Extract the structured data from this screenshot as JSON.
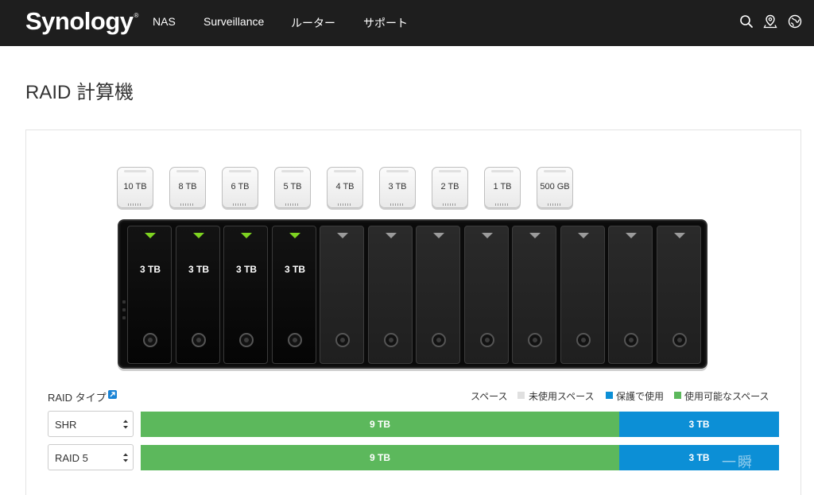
{
  "nav": {
    "logo": "Synology",
    "logo_mark": "®",
    "links": [
      "NAS",
      "Surveillance",
      "ルーター",
      "サポート"
    ],
    "icons": [
      "search-icon",
      "location-icon",
      "globe-icon"
    ]
  },
  "page_title": "RAID 計算機",
  "drive_sizes": [
    "10 TB",
    "8 TB",
    "6 TB",
    "5 TB",
    "4 TB",
    "3 TB",
    "2 TB",
    "1 TB",
    "500 GB"
  ],
  "bays": [
    {
      "label": "3 TB",
      "filled": true
    },
    {
      "label": "3 TB",
      "filled": true
    },
    {
      "label": "3 TB",
      "filled": true
    },
    {
      "label": "3 TB",
      "filled": true
    },
    {
      "label": "",
      "filled": false
    },
    {
      "label": "",
      "filled": false
    },
    {
      "label": "",
      "filled": false
    },
    {
      "label": "",
      "filled": false
    },
    {
      "label": "",
      "filled": false
    },
    {
      "label": "",
      "filled": false
    },
    {
      "label": "",
      "filled": false
    },
    {
      "label": "",
      "filled": false
    }
  ],
  "raid_type_label": "RAID タイプ",
  "legend": {
    "title": "スペース",
    "unused": "未使用スペース",
    "protection": "保護で使用",
    "available": "使用可能なスペース"
  },
  "colors": {
    "available": "#5cb85c",
    "protection": "#0c8fd6",
    "unused": "#e0e0e0",
    "led_active": "#7ed321",
    "help": "#1a84d6"
  },
  "rows": [
    {
      "raid": "SHR",
      "available": "9 TB",
      "available_fraction": 0.75,
      "protection": "3 TB"
    },
    {
      "raid": "RAID 5",
      "available": "9 TB",
      "available_fraction": 0.75,
      "protection": "3 TB"
    }
  ],
  "watermark": "一瞬"
}
